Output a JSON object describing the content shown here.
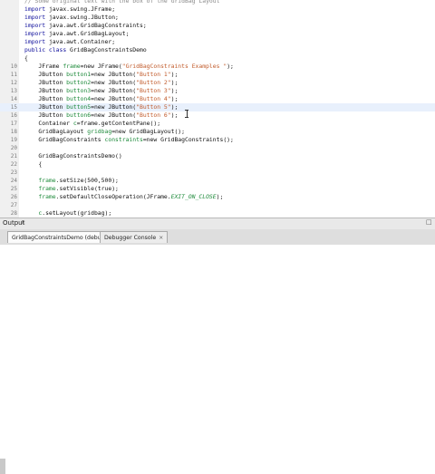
{
  "editor": {
    "header_comment": "// Some original text with the box of the GridBag Layout",
    "lines": [
      {
        "n": "",
        "tokens": [
          [
            "kw",
            "import "
          ],
          [
            "pl",
            "javax.swing.JFrame;"
          ]
        ]
      },
      {
        "n": "",
        "tokens": [
          [
            "kw",
            "import "
          ],
          [
            "pl",
            "javax.swing.JButton;"
          ]
        ]
      },
      {
        "n": "",
        "tokens": [
          [
            "kw",
            "import "
          ],
          [
            "pl",
            "java.awt.GridBagConstraints;"
          ]
        ]
      },
      {
        "n": "",
        "tokens": [
          [
            "kw",
            "import "
          ],
          [
            "pl",
            "java.awt.GridBagLayout;"
          ]
        ]
      },
      {
        "n": "",
        "tokens": [
          [
            "kw",
            "import "
          ],
          [
            "pl",
            "java.awt.Container;"
          ]
        ]
      },
      {
        "n": "",
        "tokens": [
          [
            "kw",
            "public class "
          ],
          [
            "pl",
            "GridBagConstraintsDemo"
          ]
        ]
      },
      {
        "n": "",
        "tokens": [
          [
            "pl",
            "{"
          ]
        ]
      },
      {
        "n": "10",
        "tokens": [
          [
            "pl",
            "    JFrame "
          ],
          [
            "fld",
            "frame"
          ],
          [
            "pl",
            "=new JFrame("
          ],
          [
            "str",
            "\"GridBagConstraints Examples \""
          ],
          [
            "pl",
            ");"
          ]
        ]
      },
      {
        "n": "11",
        "tokens": [
          [
            "pl",
            "    JButton "
          ],
          [
            "fld",
            "button1"
          ],
          [
            "pl",
            "=new JButton("
          ],
          [
            "str",
            "\"Button 1\""
          ],
          [
            "pl",
            ");"
          ]
        ]
      },
      {
        "n": "12",
        "tokens": [
          [
            "pl",
            "    JButton "
          ],
          [
            "fld",
            "button2"
          ],
          [
            "pl",
            "=new JButton("
          ],
          [
            "str",
            "\"Button 2\""
          ],
          [
            "pl",
            ");"
          ]
        ]
      },
      {
        "n": "13",
        "tokens": [
          [
            "pl",
            "    JButton "
          ],
          [
            "fld",
            "button3"
          ],
          [
            "pl",
            "=new JButton("
          ],
          [
            "str",
            "\"Button 3\""
          ],
          [
            "pl",
            ");"
          ]
        ]
      },
      {
        "n": "14",
        "tokens": [
          [
            "pl",
            "    JButton "
          ],
          [
            "fld",
            "button4"
          ],
          [
            "pl",
            "=new JButton("
          ],
          [
            "str",
            "\"Button 4\""
          ],
          [
            "pl",
            ");"
          ]
        ]
      },
      {
        "n": "15",
        "tokens": [
          [
            "pl",
            "    JButton "
          ],
          [
            "fld",
            "button5"
          ],
          [
            "pl",
            "=new JButton("
          ],
          [
            "str",
            "\"Button 5\""
          ],
          [
            "pl",
            ");"
          ]
        ]
      },
      {
        "n": "16",
        "tokens": [
          [
            "pl",
            "    JButton "
          ],
          [
            "fld",
            "button6"
          ],
          [
            "pl",
            "=new JButton("
          ],
          [
            "str",
            "\"Button 6\""
          ],
          [
            "pl",
            ");"
          ]
        ]
      },
      {
        "n": "17",
        "tokens": [
          [
            "pl",
            "    Container "
          ],
          [
            "fld",
            "c"
          ],
          [
            "pl",
            "=frame.getContentPane();"
          ]
        ]
      },
      {
        "n": "18",
        "tokens": [
          [
            "pl",
            "    GridBagLayout "
          ],
          [
            "fld",
            "gridbag"
          ],
          [
            "pl",
            "=new GridBagLayout();"
          ]
        ]
      },
      {
        "n": "19",
        "tokens": [
          [
            "pl",
            "    GridBagConstraints "
          ],
          [
            "fld",
            "constraints"
          ],
          [
            "pl",
            "=new GridBagConstraints();"
          ]
        ]
      },
      {
        "n": "20",
        "tokens": [
          [
            "pl",
            ""
          ]
        ]
      },
      {
        "n": "21",
        "tokens": [
          [
            "pl",
            "    GridBagConstraintsDemo()"
          ]
        ]
      },
      {
        "n": "22",
        "tokens": [
          [
            "pl",
            "    {"
          ]
        ]
      },
      {
        "n": "23",
        "tokens": [
          [
            "pl",
            ""
          ]
        ]
      },
      {
        "n": "24",
        "tokens": [
          [
            "pl",
            "    "
          ],
          [
            "fld",
            "frame"
          ],
          [
            "pl",
            ".setSize(500,500);"
          ]
        ]
      },
      {
        "n": "25",
        "tokens": [
          [
            "pl",
            "    "
          ],
          [
            "fld",
            "frame"
          ],
          [
            "pl",
            ".setVisible(true);"
          ]
        ]
      },
      {
        "n": "26",
        "tokens": [
          [
            "pl",
            "    "
          ],
          [
            "fld",
            "frame"
          ],
          [
            "pl",
            ".setDefaultCloseOperation(JFrame."
          ],
          [
            "ital",
            "EXIT_ON_CLOSE"
          ],
          [
            "pl",
            ");"
          ]
        ]
      },
      {
        "n": "27",
        "tokens": [
          [
            "pl",
            ""
          ]
        ]
      },
      {
        "n": "28",
        "tokens": [
          [
            "pl",
            "    "
          ],
          [
            "fld",
            "c"
          ],
          [
            "pl",
            ".setLayout(gridbag);"
          ]
        ]
      }
    ],
    "highlighted_line": "15"
  },
  "output": {
    "title": "Output",
    "close": "×",
    "minimize": "□"
  },
  "tabs": [
    {
      "label": "GridBagConstraintsDemo (debug)",
      "close": "×"
    },
    {
      "label": "Debugger Console",
      "close": "×"
    }
  ],
  "colors": {
    "keyword": "#0b0b9a",
    "string": "#c15a2a",
    "field": "#1d8a3a",
    "highlight": "#e8f0fc"
  }
}
